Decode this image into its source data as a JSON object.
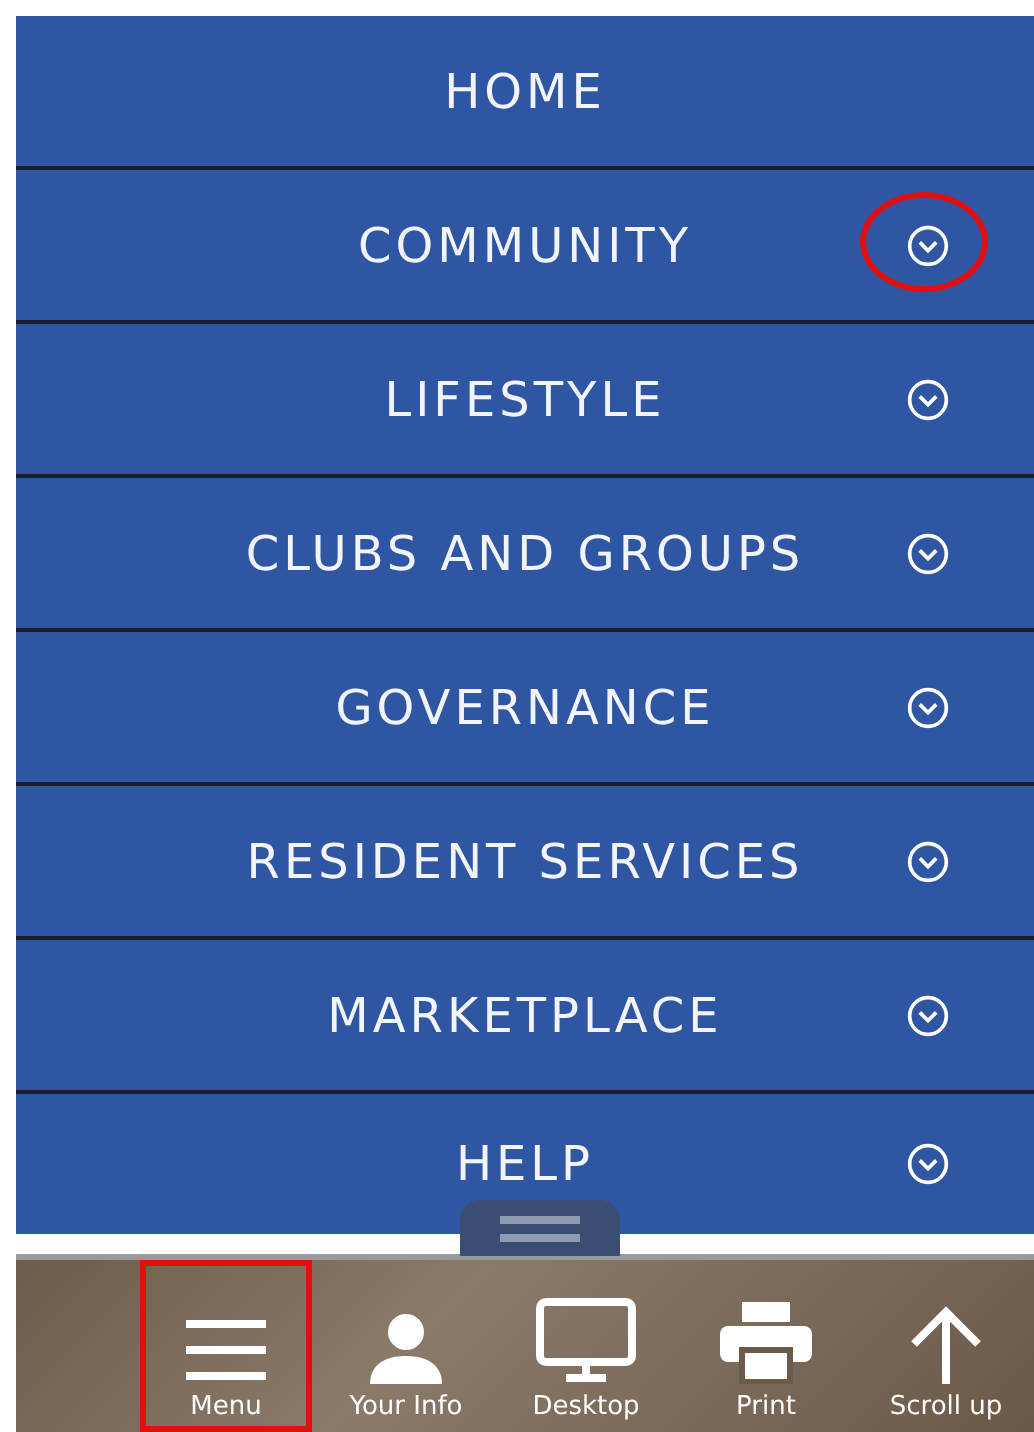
{
  "menu_items": [
    {
      "label": "HOME",
      "expandable": false,
      "circled": false
    },
    {
      "label": "COMMUNITY",
      "expandable": true,
      "circled": true
    },
    {
      "label": "LIFESTYLE",
      "expandable": true,
      "circled": false
    },
    {
      "label": "CLUBS AND GROUPS",
      "expandable": true,
      "circled": false
    },
    {
      "label": "GOVERNANCE",
      "expandable": true,
      "circled": false
    },
    {
      "label": "RESIDENT SERVICES",
      "expandable": true,
      "circled": false
    },
    {
      "label": "MARKETPLACE",
      "expandable": true,
      "circled": false
    },
    {
      "label": "HELP",
      "expandable": true,
      "circled": false
    }
  ],
  "toolbar": [
    {
      "kind": "menu",
      "label": "Menu",
      "highlighted": true
    },
    {
      "kind": "person",
      "label": "Your Info",
      "highlighted": false
    },
    {
      "kind": "monitor",
      "label": "Desktop",
      "highlighted": false
    },
    {
      "kind": "printer",
      "label": "Print",
      "highlighted": false
    },
    {
      "kind": "arrow-up",
      "label": "Scroll up",
      "highlighted": false
    }
  ]
}
